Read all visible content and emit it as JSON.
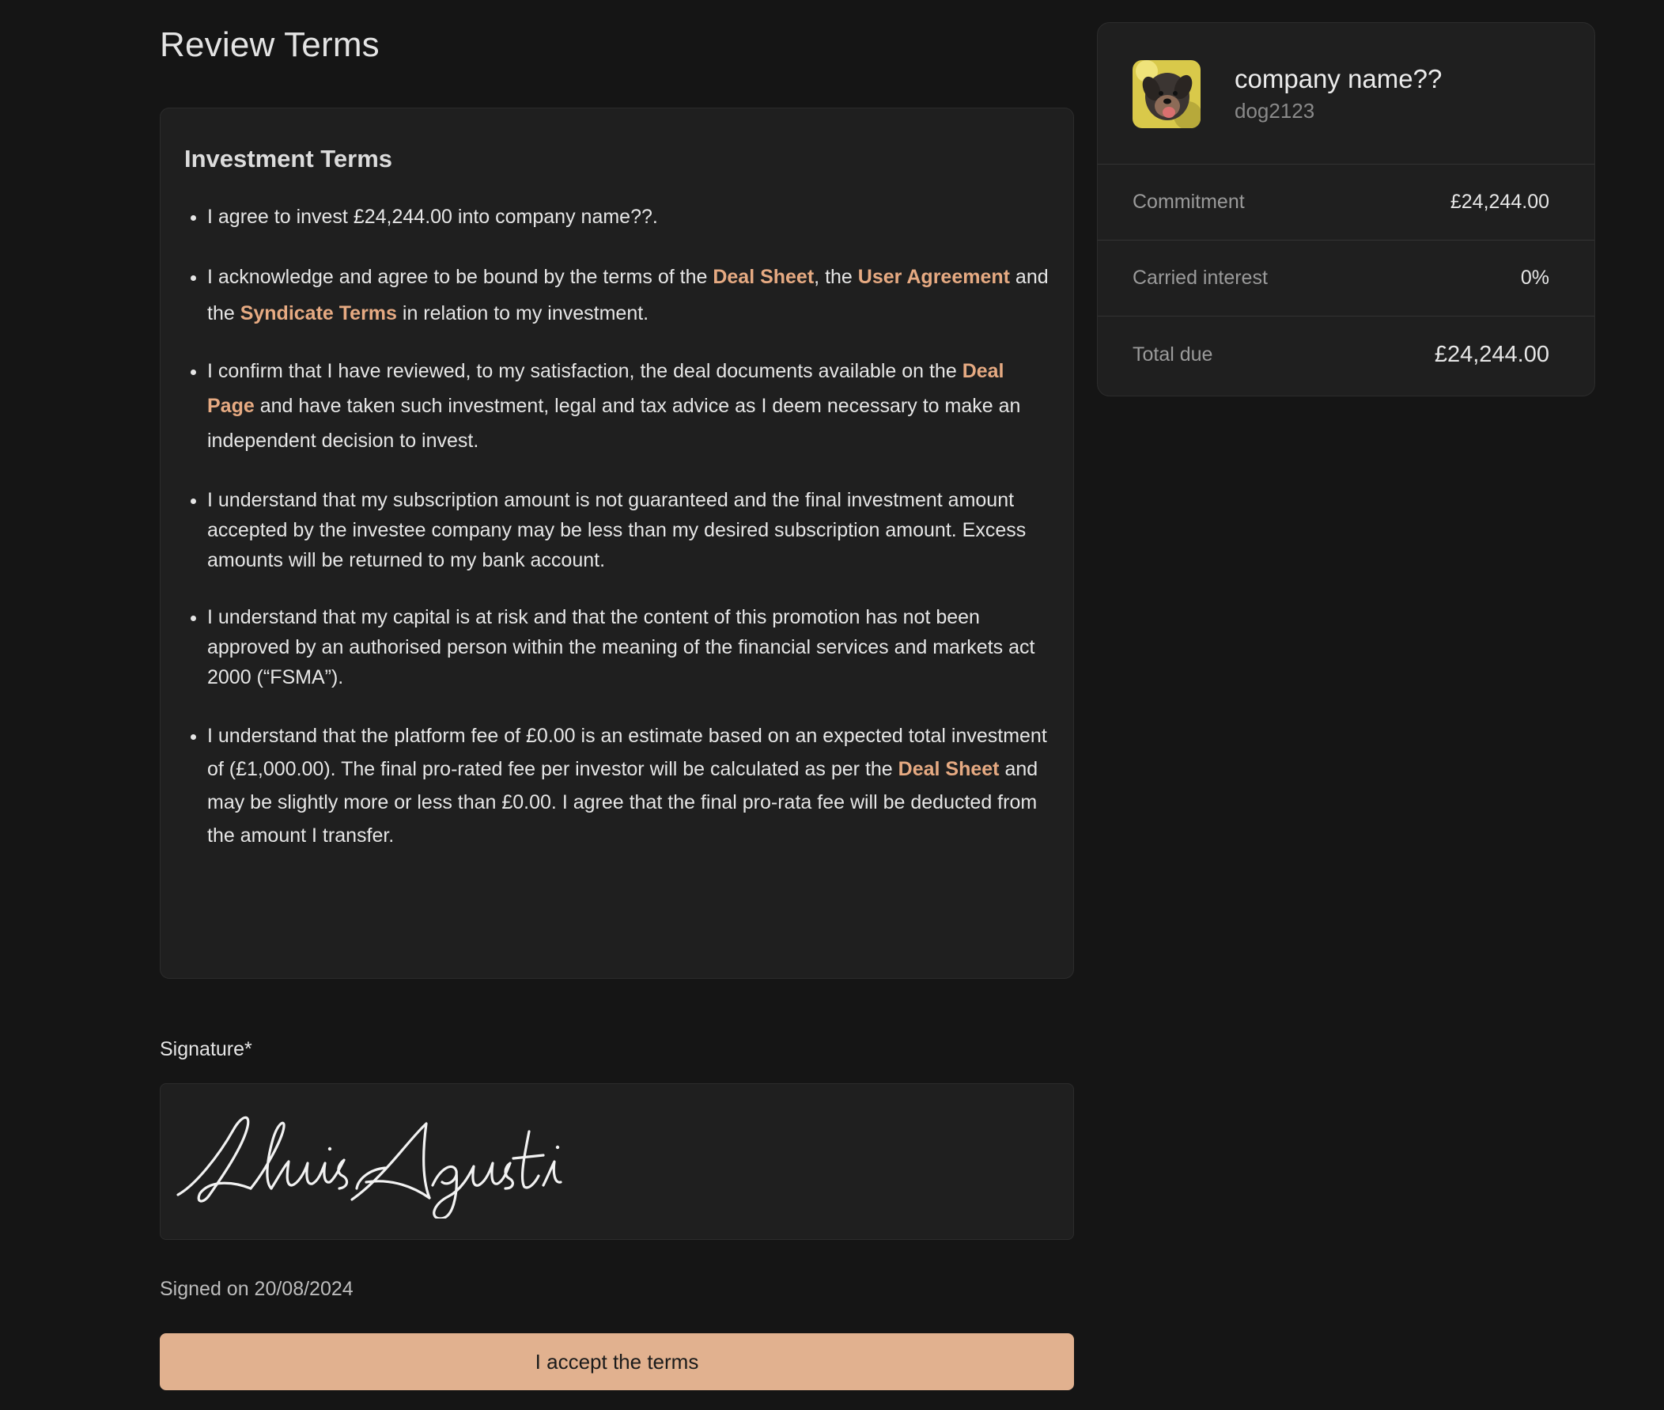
{
  "page": {
    "title": "Review Terms"
  },
  "terms": {
    "heading": "Investment Terms",
    "item1": "I agree to invest £24,244.00 into company name??.",
    "item2": {
      "t1": "I acknowledge and agree to be bound by the terms of the ",
      "link_deal_sheet": "Deal Sheet",
      "t2": ", the ",
      "link_user_agreement": "User Agreement",
      "t3": " and the ",
      "link_syndicate_terms": "Syndicate Terms",
      "t4": " in relation to my investment."
    },
    "item3": {
      "t1": "I confirm that I have reviewed, to my satisfaction, the deal documents available on the ",
      "link_deal_page": "Deal Page",
      "t2": " and have taken such investment, legal and tax advice as I deem necessary to make an independent decision to invest."
    },
    "item4": "I understand that my subscription amount is not guaranteed and the final investment amount accepted by the investee company may be less than my desired subscription amount. Excess amounts will be returned to my bank account.",
    "item5": "I understand that my capital is at risk and that the content of this promotion has not been approved by an authorised person within the meaning of the financial services and markets act 2000 (“FSMA”).",
    "item6": {
      "t1": "I understand that the platform fee of £0.00 is an estimate based on an expected total investment of (£1,000.00). The final pro-rated fee per investor will be calculated as per the ",
      "link_deal_sheet": "Deal Sheet",
      "t2": " and may be slightly more or less than £0.00. I agree that the final pro-rata fee will be deducted from the amount I transfer."
    }
  },
  "signature": {
    "label": "Signature*",
    "name": "Lluis Agusti",
    "signed_on": "Signed on 20/08/2024"
  },
  "accept_button": {
    "label": "I accept the terms"
  },
  "summary": {
    "company_name": "company name??",
    "handle": "dog2123",
    "avatar_icon": "dog-photo-avatar",
    "rows": [
      {
        "label": "Commitment",
        "value": "£24,244.00"
      },
      {
        "label": "Carried interest",
        "value": "0%"
      },
      {
        "label": "Total due",
        "value": "£24,244.00"
      }
    ]
  },
  "colors": {
    "background": "#151515",
    "card": "#1f1f1f",
    "link": "#e6aa82",
    "button": "#e1b18f"
  }
}
